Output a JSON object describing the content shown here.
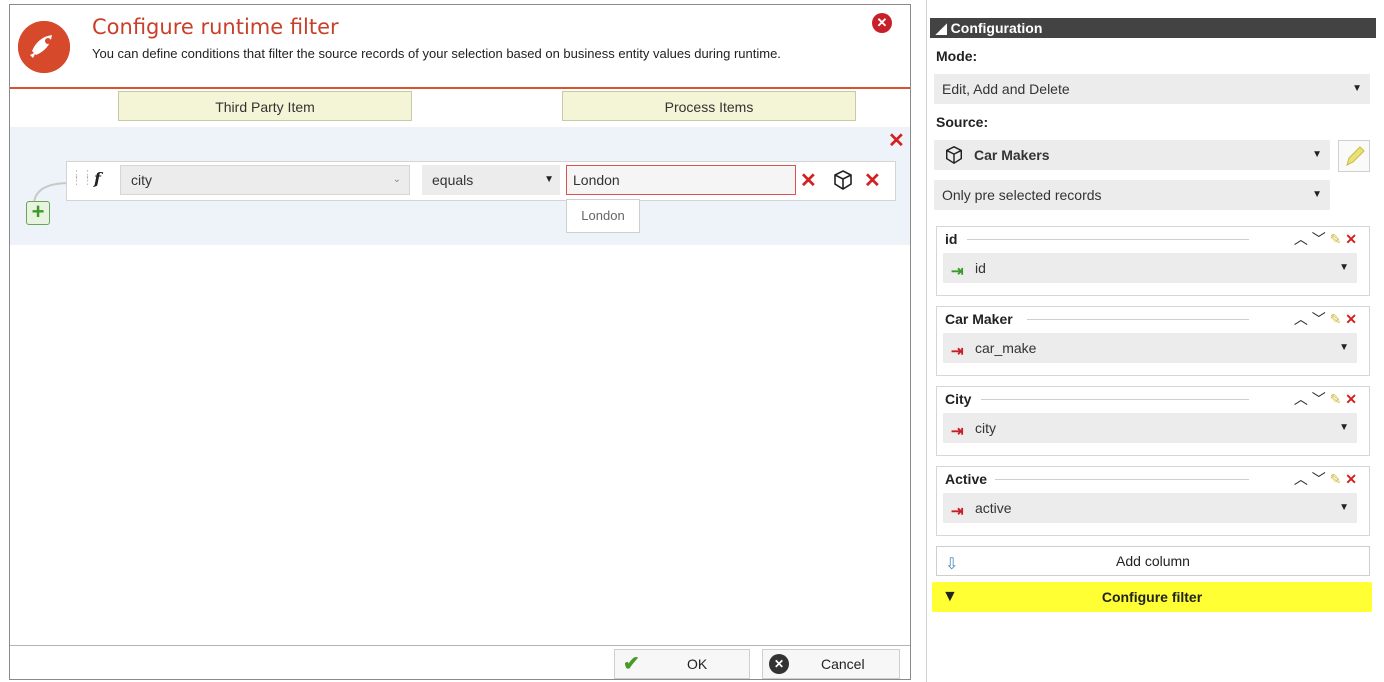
{
  "dialog": {
    "title": "Configure runtime filter",
    "description": "You can define conditions that filter the source records of your selection based on business entity values during runtime.",
    "close_glyph": "✕",
    "tabs": [
      {
        "label": "Third Party Item"
      },
      {
        "label": "Process Items"
      }
    ],
    "condition": {
      "function_glyph": "f",
      "field": "city",
      "operator": "equals",
      "value": "London",
      "suggestion": "London"
    },
    "add_glyph": "+",
    "ok_label": "OK",
    "cancel_label": "Cancel"
  },
  "config": {
    "header": "◢ Configuration",
    "mode_label": "Mode:",
    "mode_value": "Edit, Add and Delete",
    "source_label": "Source:",
    "source_value": "Car Makers",
    "records_value": "Only pre selected records",
    "columns": [
      {
        "title": "id",
        "value": "id",
        "icon": "output-arrow-icon"
      },
      {
        "title": "Car Maker",
        "value": "car_make",
        "icon": "input-arrow-icon"
      },
      {
        "title": "City",
        "value": "city",
        "icon": "input-arrow-icon"
      },
      {
        "title": "Active",
        "value": "active",
        "icon": "input-arrow-icon"
      }
    ],
    "add_column_label": "Add column",
    "configure_filter_label": "Configure filter"
  },
  "colors": {
    "accent_red": "#c8402a",
    "highlight_yellow": "#ffff33",
    "header_dark": "#434343"
  }
}
